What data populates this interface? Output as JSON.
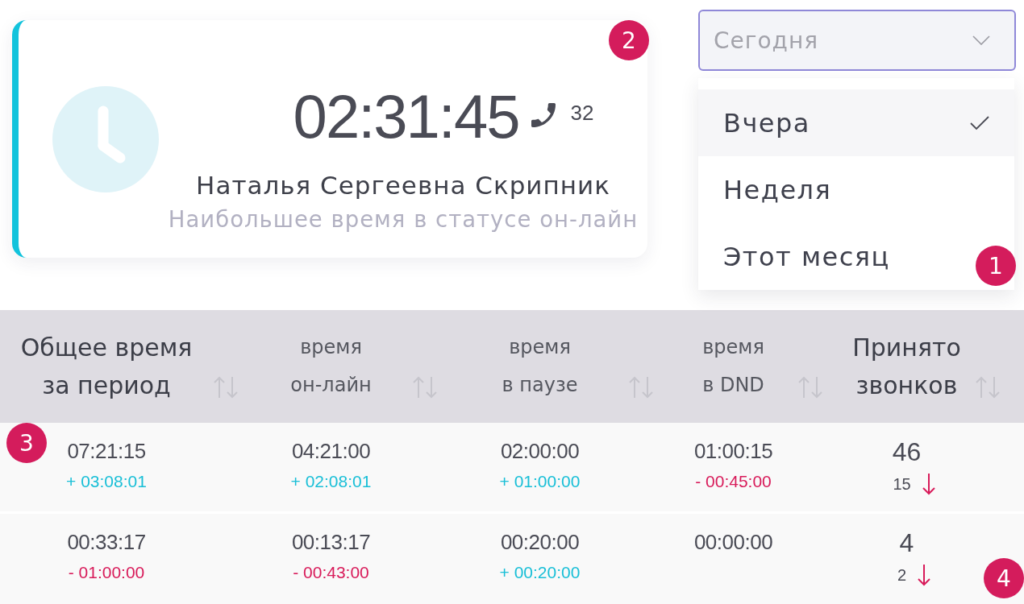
{
  "summary_card": {
    "time": "02:31:45",
    "calls": "32",
    "name": "Наталья Сергеевна Скрипник",
    "caption": "Наибольшее время в статусе он-лайн"
  },
  "period_select": {
    "value": "Сегодня",
    "options": [
      {
        "label": "Вчера",
        "selected": true
      },
      {
        "label": "Неделя",
        "selected": false
      },
      {
        "label": "Этот месяц",
        "selected": false
      }
    ]
  },
  "table": {
    "columns": [
      {
        "label": "Общее время\nза период",
        "kind": "major"
      },
      {
        "label": "время\nон-лайн",
        "kind": "minor"
      },
      {
        "label": "время\nв паузе",
        "kind": "minor"
      },
      {
        "label": "время\nв DND",
        "kind": "minor"
      },
      {
        "label": "Принято\nзвонков",
        "kind": "major"
      }
    ],
    "rows": [
      {
        "cells": [
          {
            "kind": "time",
            "value": "07:21:15",
            "delta": {
              "text": "+ 03:08:01",
              "color": "#19bfd7"
            }
          },
          {
            "kind": "time",
            "value": "04:21:00",
            "delta": {
              "text": "+ 02:08:01",
              "color": "#19bfd7"
            }
          },
          {
            "kind": "time",
            "value": "02:00:00",
            "delta": {
              "text": "+ 01:00:00",
              "color": "#19bfd7"
            }
          },
          {
            "kind": "time",
            "value": "01:00:15",
            "delta": {
              "text": "- 00:45:00",
              "color": "#d81b5a"
            }
          },
          {
            "kind": "count",
            "value": "46",
            "change": "15",
            "decreased": true
          }
        ]
      },
      {
        "cells": [
          {
            "kind": "time",
            "value": "00:33:17",
            "delta": {
              "text": "- 01:00:00",
              "color": "#d81b5a"
            }
          },
          {
            "kind": "time",
            "value": "00:13:17",
            "delta": {
              "text": "- 00:43:00",
              "color": "#d81b5a"
            }
          },
          {
            "kind": "time",
            "value": "00:20:00",
            "delta": {
              "text": "+ 00:20:00",
              "color": "#19bfd7"
            }
          },
          {
            "kind": "time",
            "value": "00:00:00"
          },
          {
            "kind": "count",
            "value": "4",
            "change": "2",
            "decreased": true
          }
        ]
      }
    ]
  },
  "callouts": [
    {
      "label": "1"
    },
    {
      "label": "2"
    },
    {
      "label": "3"
    },
    {
      "label": "4"
    }
  ]
}
